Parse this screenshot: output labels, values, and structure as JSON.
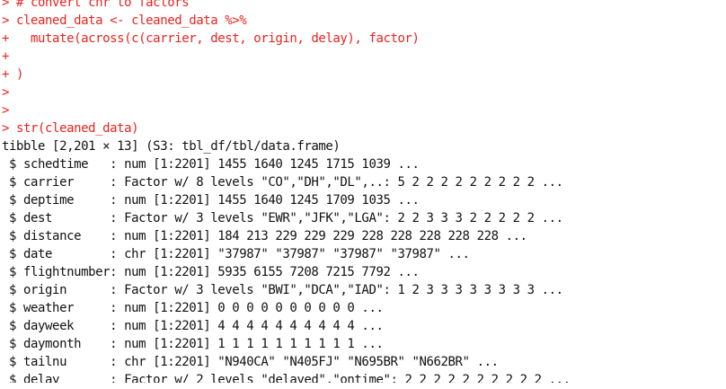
{
  "console": {
    "colors": {
      "command": "#e8231e",
      "output": "#111111",
      "background": "#ffffff"
    },
    "lines": [
      {
        "type": "command",
        "text": "> # convert chr to factors"
      },
      {
        "type": "command",
        "text": "> cleaned_data <- cleaned_data %>%"
      },
      {
        "type": "command",
        "text": "+   mutate(across(c(carrier, dest, origin, delay), factor)"
      },
      {
        "type": "command",
        "text": "+"
      },
      {
        "type": "command",
        "text": "+ )"
      },
      {
        "type": "command",
        "text": ">"
      },
      {
        "type": "command",
        "text": ">"
      },
      {
        "type": "command",
        "text": "> str(cleaned_data)"
      },
      {
        "type": "output",
        "text": "tibble [2,201 × 13] (S3: tbl_df/tbl/data.frame)"
      },
      {
        "type": "output",
        "text": " $ schedtime   : num [1:2201] 1455 1640 1245 1715 1039 ..."
      },
      {
        "type": "output",
        "text": " $ carrier     : Factor w/ 8 levels \"CO\",\"DH\",\"DL\",..: 5 2 2 2 2 2 2 2 2 2 ..."
      },
      {
        "type": "output",
        "text": " $ deptime     : num [1:2201] 1455 1640 1245 1709 1035 ..."
      },
      {
        "type": "output",
        "text": " $ dest        : Factor w/ 3 levels \"EWR\",\"JFK\",\"LGA\": 2 2 3 3 3 2 2 2 2 2 ..."
      },
      {
        "type": "output",
        "text": " $ distance    : num [1:2201] 184 213 229 229 229 228 228 228 228 228 ..."
      },
      {
        "type": "output",
        "text": " $ date        : chr [1:2201] \"37987\" \"37987\" \"37987\" \"37987\" ..."
      },
      {
        "type": "output",
        "text": " $ flightnumber: num [1:2201] 5935 6155 7208 7215 7792 ..."
      },
      {
        "type": "output",
        "text": " $ origin      : Factor w/ 3 levels \"BWI\",\"DCA\",\"IAD\": 1 2 3 3 3 3 3 3 3 3 ..."
      },
      {
        "type": "output",
        "text": " $ weather     : num [1:2201] 0 0 0 0 0 0 0 0 0 0 ..."
      },
      {
        "type": "output",
        "text": " $ dayweek     : num [1:2201] 4 4 4 4 4 4 4 4 4 4 ..."
      },
      {
        "type": "output",
        "text": " $ daymonth    : num [1:2201] 1 1 1 1 1 1 1 1 1 1 ..."
      },
      {
        "type": "output",
        "text": " $ tailnu      : chr [1:2201] \"N940CA\" \"N405FJ\" \"N695BR\" \"N662BR\" ..."
      },
      {
        "type": "output",
        "text": " $ delay       : Factor w/ 2 levels \"delayed\",\"ontime\": 2 2 2 2 2 2 2 2 2 2 ..."
      }
    ]
  }
}
